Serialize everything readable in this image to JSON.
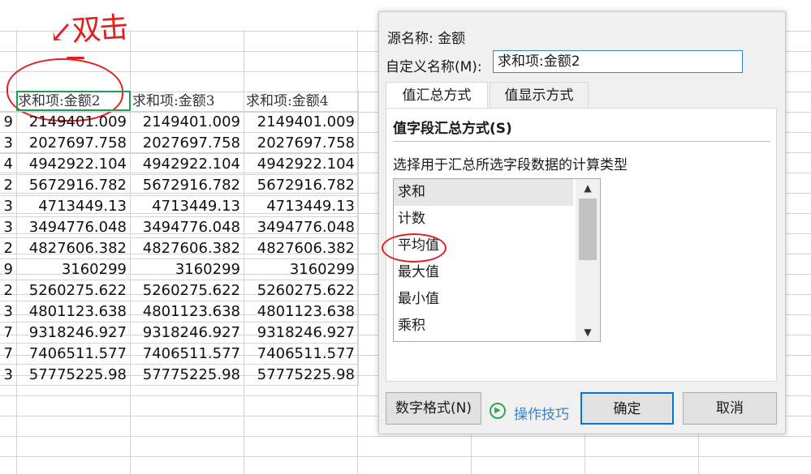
{
  "annotation": {
    "text": "↙双击"
  },
  "table": {
    "headers": [
      "",
      "求和项:金额2",
      "求和项:金额3",
      "求和项:金额4"
    ],
    "rows": [
      [
        "9",
        "2149401.009",
        "2149401.009",
        "2149401.009"
      ],
      [
        "3",
        "2027697.758",
        "2027697.758",
        "2027697.758"
      ],
      [
        "4",
        "4942922.104",
        "4942922.104",
        "4942922.104"
      ],
      [
        "2",
        "5672916.782",
        "5672916.782",
        "5672916.782"
      ],
      [
        "3",
        "4713449.13",
        "4713449.13",
        "4713449.13"
      ],
      [
        "3",
        "3494776.048",
        "3494776.048",
        "3494776.048"
      ],
      [
        "2",
        "4827606.382",
        "4827606.382",
        "4827606.382"
      ],
      [
        "9",
        "3160299",
        "3160299",
        "3160299"
      ],
      [
        "2",
        "5260275.622",
        "5260275.622",
        "5260275.622"
      ],
      [
        "3",
        "4801123.638",
        "4801123.638",
        "4801123.638"
      ],
      [
        "7",
        "9318246.927",
        "9318246.927",
        "9318246.927"
      ],
      [
        "7",
        "7406511.577",
        "7406511.577",
        "7406511.577"
      ],
      [
        "3",
        "57775225.98",
        "57775225.98",
        "57775225.98"
      ]
    ]
  },
  "dialog": {
    "source_name": "源名称: 金额",
    "custom_name_label": "自定义名称(M):",
    "custom_name_value": "求和项:金额2",
    "tabs": [
      "值汇总方式",
      "值显示方式"
    ],
    "section_title": "值字段汇总方式(S)",
    "section_desc": "选择用于汇总所选字段数据的计算类型",
    "list_items": [
      "求和",
      "计数",
      "平均值",
      "最大值",
      "最小值",
      "乘积"
    ],
    "selected_item": "求和",
    "buttons": {
      "format": "数字格式(N)",
      "tips": "操作技巧",
      "ok": "确定",
      "cancel": "取消"
    }
  },
  "colors": {
    "annotation": "#e02020",
    "selection": "#1f9d55",
    "accent": "#0078d7",
    "link": "#3c82c8"
  }
}
